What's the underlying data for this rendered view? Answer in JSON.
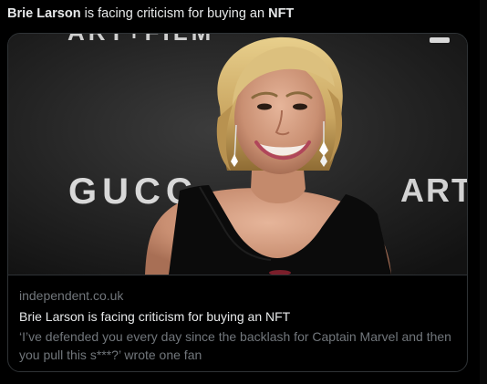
{
  "tweet": {
    "text_bold_name": "Brie Larson",
    "text_middle": " is facing criticism for buying an ",
    "text_bold_nft": "NFT"
  },
  "card": {
    "image": {
      "backdrop_text_left": "GUCC",
      "backdrop_text_right": "ART",
      "backdrop_text_top": "ART+FILM"
    },
    "domain": "independent.co.uk",
    "title": "Brie Larson is facing criticism for buying an NFT",
    "description": "‘I’ve defended you every day since the backlash for Captain Marvel and then you pull this s***?’ wrote one fan"
  },
  "colors": {
    "background": "#000000",
    "primary_text": "#e7e9ea",
    "secondary_text": "#71767b",
    "border": "#2f3336"
  }
}
